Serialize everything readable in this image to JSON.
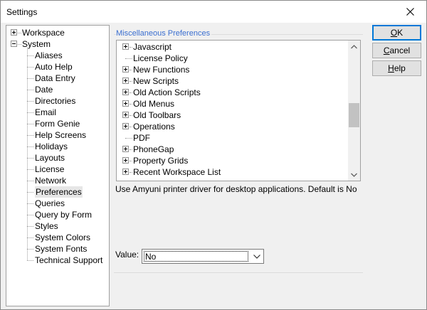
{
  "window": {
    "title": "Settings"
  },
  "tree": {
    "nodes": [
      {
        "label": "Workspace",
        "level": 0,
        "expander": "plus"
      },
      {
        "label": "System",
        "level": 0,
        "expander": "minus"
      },
      {
        "label": "Aliases",
        "level": 1
      },
      {
        "label": "Auto Help",
        "level": 1
      },
      {
        "label": "Data Entry",
        "level": 1
      },
      {
        "label": "Date",
        "level": 1
      },
      {
        "label": "Directories",
        "level": 1
      },
      {
        "label": "Email",
        "level": 1
      },
      {
        "label": "Form Genie",
        "level": 1
      },
      {
        "label": "Help Screens",
        "level": 1
      },
      {
        "label": "Holidays",
        "level": 1
      },
      {
        "label": "Layouts",
        "level": 1
      },
      {
        "label": "License",
        "level": 1
      },
      {
        "label": "Network",
        "level": 1
      },
      {
        "label": "Preferences",
        "level": 1,
        "selected": true
      },
      {
        "label": "Queries",
        "level": 1
      },
      {
        "label": "Query by Form",
        "level": 1
      },
      {
        "label": "Styles",
        "level": 1
      },
      {
        "label": "System Colors",
        "level": 1
      },
      {
        "label": "System Fonts",
        "level": 1
      },
      {
        "label": "Technical Support",
        "level": 1
      }
    ]
  },
  "preferences": {
    "group_label": "Miscellaneous Preferences",
    "items": [
      {
        "label": "Javascript",
        "expander": "plus"
      },
      {
        "label": "License Policy",
        "expander": "none"
      },
      {
        "label": "New Functions",
        "expander": "plus"
      },
      {
        "label": "New Scripts",
        "expander": "plus"
      },
      {
        "label": "Old Action Scripts",
        "expander": "plus"
      },
      {
        "label": "Old Menus",
        "expander": "plus"
      },
      {
        "label": "Old Toolbars",
        "expander": "plus"
      },
      {
        "label": "Operations",
        "expander": "plus"
      },
      {
        "label": "PDF",
        "expander": "none"
      },
      {
        "label": "PhoneGap",
        "expander": "plus"
      },
      {
        "label": "Property Grids",
        "expander": "plus"
      },
      {
        "label": "Recent Workspace List",
        "expander": "plus"
      }
    ],
    "description": "Use Amyuni printer driver for desktop applications. Default is No",
    "value_label": "Value:",
    "value": "No"
  },
  "buttons": {
    "ok_pre": "",
    "ok_ul": "O",
    "ok_post": "K",
    "cancel_pre": "",
    "cancel_ul": "C",
    "cancel_post": "ancel",
    "help_pre": "",
    "help_ul": "H",
    "help_post": "elp"
  },
  "colors": {
    "group_label": "#3b6fd0",
    "default_button_border": "#0078d7",
    "scroll_thumb": "#c2c2c2"
  }
}
